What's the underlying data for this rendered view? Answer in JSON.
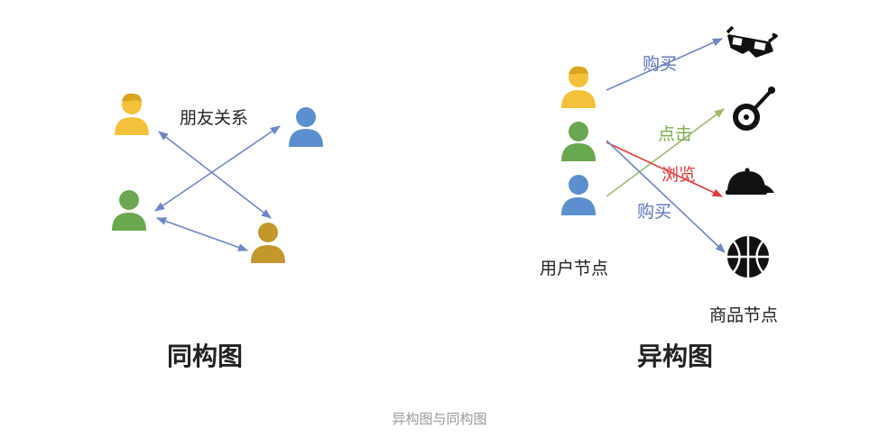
{
  "colors": {
    "edge_blue": "#6f86c9",
    "edge_green": "#9dbb6a",
    "edge_red": "#e53a3a",
    "label_blue": "#5b73c4",
    "label_green": "#78b04a",
    "label_red": "#e53a3a",
    "user_yellow": "#f3c23a",
    "user_blue": "#5b8fd0",
    "user_green": "#6aa84f",
    "user_gold": "#c2972c",
    "item_black": "#111111"
  },
  "homogeneous": {
    "title": "同构图",
    "relation_label": "朋友关系",
    "users": [
      {
        "id": "user-yellow",
        "color": "user_yellow",
        "hair": true
      },
      {
        "id": "user-blue",
        "color": "user_blue",
        "hair": false
      },
      {
        "id": "user-green",
        "color": "user_green",
        "hair": false
      },
      {
        "id": "user-gold",
        "color": "user_gold",
        "hair": false
      }
    ]
  },
  "heterogeneous": {
    "title": "异构图",
    "user_nodes_label": "用户节点",
    "item_nodes_label": "商品节点",
    "users": [
      {
        "id": "user-yellow",
        "color": "user_yellow",
        "hair": true
      },
      {
        "id": "user-green",
        "color": "user_green",
        "hair": false
      },
      {
        "id": "user-blue",
        "color": "user_blue",
        "hair": false
      }
    ],
    "items": [
      {
        "id": "3d-glasses",
        "icon": "3d-glasses-icon"
      },
      {
        "id": "banjo",
        "icon": "banjo-icon"
      },
      {
        "id": "cap",
        "icon": "cap-icon"
      },
      {
        "id": "basketball",
        "icon": "basketball-icon"
      }
    ],
    "edges": [
      {
        "from": "user-yellow",
        "to": "3d-glasses",
        "label": "购买",
        "color": "edge_blue"
      },
      {
        "from": "user-blue",
        "to": "banjo",
        "label": "点击",
        "color": "edge_green"
      },
      {
        "from": "user-green",
        "to": "cap",
        "label": "浏览",
        "color": "edge_red"
      },
      {
        "from": "user-green",
        "to": "basketball",
        "label": "购买",
        "color": "edge_blue"
      }
    ]
  },
  "caption": "异构图与同构图"
}
